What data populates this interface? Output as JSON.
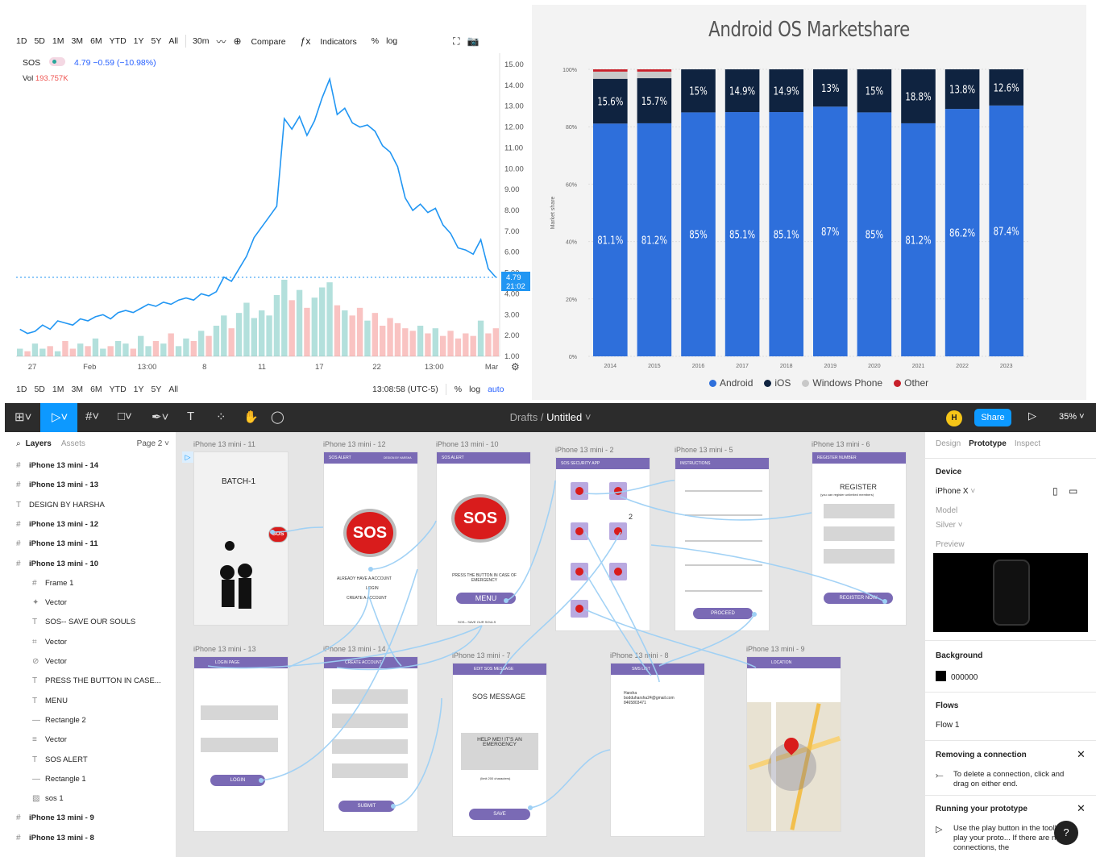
{
  "stock": {
    "timeframes": [
      "1D",
      "5D",
      "1M",
      "3M",
      "6M",
      "YTD",
      "1Y",
      "5Y",
      "All"
    ],
    "interval": "30m",
    "compare_label": "Compare",
    "indicators_label": "Indicators",
    "percent_label": "%",
    "log_label": "log",
    "symbol": "SOS",
    "change": "4.79 −0.59 (−10.98%)",
    "volume_label": "Vol",
    "volume_value": "193.757K",
    "price_tag": "4.79",
    "time_tag": "21:02",
    "clock": "13:08:58 (UTC-5)",
    "auto_label": "auto",
    "up_color": "#26a69a",
    "down_color": "#ef5350",
    "line_color": "#2196f3"
  },
  "android_chart": {
    "title": "Android OS Marketshare",
    "ylabel": "Market share",
    "legend": [
      "Android",
      "iOS",
      "Windows Phone",
      "Other"
    ]
  },
  "chart_data": [
    {
      "type": "line",
      "title": "",
      "xlabel": "",
      "ylabel": "",
      "x_ticks": [
        "27",
        "Feb",
        "13:00",
        "8",
        "11",
        "17",
        "22",
        "13:00",
        "Mar"
      ],
      "y_ticks": [
        "1.00",
        "2.00",
        "3.00",
        "4.00",
        "5.00",
        "6.00",
        "7.00",
        "8.00",
        "9.00",
        "10.00",
        "11.00",
        "12.00",
        "13.00",
        "14.00",
        "15.00"
      ],
      "ylim": [
        1,
        15
      ],
      "price": [
        2.3,
        2.1,
        2.2,
        2.5,
        2.3,
        2.7,
        2.6,
        2.5,
        2.8,
        2.7,
        2.9,
        3.0,
        2.8,
        3.1,
        3.2,
        3.1,
        3.3,
        3.5,
        3.4,
        3.6,
        3.5,
        3.7,
        3.8,
        3.7,
        4.0,
        3.9,
        4.1,
        4.8,
        4.6,
        5.2,
        5.8,
        6.7,
        7.2,
        7.7,
        8.2,
        12.4,
        11.9,
        12.5,
        11.6,
        12.3,
        13.4,
        14.3,
        12.6,
        12.9,
        12.2,
        12.0,
        12.1,
        11.8,
        11.1,
        10.8,
        10.1,
        8.6,
        8.0,
        8.3,
        7.9,
        8.1,
        7.3,
        6.9,
        6.2,
        6.1,
        5.9,
        6.6,
        5.2,
        4.79
      ],
      "volume": [
        0.3,
        0.2,
        0.5,
        0.3,
        0.4,
        0.2,
        0.6,
        0.3,
        0.5,
        0.4,
        0.7,
        0.3,
        0.4,
        0.6,
        0.5,
        0.3,
        0.8,
        0.4,
        0.6,
        0.5,
        0.9,
        0.4,
        0.7,
        0.6,
        1.0,
        0.8,
        1.2,
        1.6,
        1.1,
        1.7,
        2.1,
        1.5,
        1.8,
        1.6,
        2.4,
        3.0,
        2.2,
        2.6,
        1.9,
        2.3,
        2.7,
        2.9,
        2.0,
        1.8,
        1.6,
        1.9,
        1.4,
        1.7,
        1.2,
        1.5,
        1.3,
        1.1,
        1.0,
        1.2,
        0.9,
        1.1,
        0.8,
        1.0,
        0.7,
        0.9,
        0.8,
        1.4,
        0.9,
        1.1
      ],
      "last_price": 4.79
    },
    {
      "type": "bar",
      "title": "Android OS Marketshare",
      "ylabel": "Market share",
      "categories": [
        "2014",
        "2015",
        "2016",
        "2017",
        "2018",
        "2019",
        "2020",
        "2021",
        "2022",
        "2023"
      ],
      "y_ticks": [
        "0%",
        "20%",
        "40%",
        "60%",
        "80%",
        "100%"
      ],
      "ylim": [
        0,
        100
      ],
      "stacked": true,
      "series": [
        {
          "name": "Android",
          "color": "#2e6fdb",
          "values": [
            81.1,
            81.2,
            85,
            85.1,
            85.1,
            87,
            85,
            81.2,
            86.2,
            87.4
          ],
          "labels": [
            "81.1%",
            "81.2%",
            "85%",
            "85.1%",
            "85.1%",
            "87%",
            "85%",
            "81.2%",
            "86.2%",
            "87.4%"
          ]
        },
        {
          "name": "iOS",
          "color": "#0f2340",
          "values": [
            15.6,
            15.7,
            15,
            14.9,
            14.9,
            13,
            15,
            18.8,
            13.8,
            12.6
          ],
          "labels": [
            "15.6%",
            "15.7%",
            "15%",
            "14.9%",
            "14.9%",
            "13%",
            "15%",
            "18.8%",
            "13.8%",
            "12.6%"
          ]
        },
        {
          "name": "Windows Phone",
          "color": "#c8c8c8",
          "values": [
            2.5,
            2.3,
            0,
            0,
            0,
            0,
            0,
            0,
            0,
            0
          ]
        },
        {
          "name": "Other",
          "color": "#c8202a",
          "values": [
            0.8,
            0.8,
            0,
            0,
            0,
            0,
            0,
            0,
            0,
            0
          ]
        }
      ],
      "legend_position": "bottom"
    }
  ],
  "figma": {
    "breadcrumb_drafts": "Drafts",
    "separator": "/",
    "file_name": "Untitled",
    "avatar_letter": "H",
    "share_label": "Share",
    "zoom": "35%",
    "layers_tab": "Layers",
    "assets_tab": "Assets",
    "page": "Page 2",
    "layers": [
      {
        "icon": "#",
        "label": "iPhone 13 mini - 14",
        "bold": true,
        "indent": 0
      },
      {
        "icon": "#",
        "label": "iPhone 13 mini - 13",
        "bold": true,
        "indent": 0
      },
      {
        "icon": "T",
        "label": "DESIGN BY HARSHA",
        "bold": false,
        "indent": 0
      },
      {
        "icon": "#",
        "label": "iPhone 13 mini - 12",
        "bold": true,
        "indent": 0
      },
      {
        "icon": "#",
        "label": "iPhone 13 mini - 11",
        "bold": true,
        "indent": 0
      },
      {
        "icon": "#",
        "label": "iPhone 13 mini - 10",
        "bold": true,
        "indent": 0
      },
      {
        "icon": "#",
        "label": "Frame 1",
        "bold": false,
        "indent": 1
      },
      {
        "icon": "✦",
        "label": "Vector",
        "bold": false,
        "indent": 1
      },
      {
        "icon": "T",
        "label": "SOS-- SAVE OUR SOULS",
        "bold": false,
        "indent": 1
      },
      {
        "icon": "⌗",
        "label": "Vector",
        "bold": false,
        "indent": 1
      },
      {
        "icon": "⊘",
        "label": "Vector",
        "bold": false,
        "indent": 1
      },
      {
        "icon": "T",
        "label": "PRESS THE BUTTON IN CASE...",
        "bold": false,
        "indent": 1
      },
      {
        "icon": "T",
        "label": "MENU",
        "bold": false,
        "indent": 1
      },
      {
        "icon": "—",
        "label": "Rectangle 2",
        "bold": false,
        "indent": 1
      },
      {
        "icon": "≡",
        "label": "Vector",
        "bold": false,
        "indent": 1
      },
      {
        "icon": "T",
        "label": "SOS ALERT",
        "bold": false,
        "indent": 1
      },
      {
        "icon": "—",
        "label": "Rectangle 1",
        "bold": false,
        "indent": 1
      },
      {
        "icon": "▨",
        "label": "sos 1",
        "bold": false,
        "indent": 1
      },
      {
        "icon": "#",
        "label": "iPhone 13 mini - 9",
        "bold": true,
        "indent": 0
      },
      {
        "icon": "#",
        "label": "iPhone 13 mini - 8",
        "bold": true,
        "indent": 0
      }
    ],
    "frames_row1": [
      "iPhone 13 mini - 11",
      "iPhone 13 mini - 12",
      "iPhone 13 mini - 10",
      "iPhone 13 mini - 2",
      "iPhone 13 mini - 5",
      "iPhone 13 mini - 6"
    ],
    "frames_row2": [
      "iPhone 13 mini - 13",
      "iPhone 13 mini - 14",
      "iPhone 13 mini - 7",
      "iPhone 13 mini - 8",
      "iPhone 13 mini - 9"
    ],
    "screens": {
      "batch": "BATCH-1",
      "sos": "SOS",
      "sos_alert": "SOS ALERT",
      "design_by": "DESIGN BY HARSHA",
      "already": "ALREADY HAVE A ACCOUNT",
      "login": "LOGIN",
      "create": "CREATE A ACCOUNT",
      "press": "PRESS THE BUTTON IN CASE OF EMERGENCY",
      "menu": "MENU",
      "save_our": "SOS-- SAVE OUR SOULS",
      "security_app": "SOS SECURITY APP",
      "instructions": "INSTRUCTIONS",
      "proceed": "PROCEED",
      "register_number": "REGISTER NUMBER",
      "register": "REGISTER",
      "register_sub": "(you can register unlimited members)",
      "register_now": "REGISTER NOW",
      "login_page": "LOGIN PAGE",
      "create_account": "CREATE ACCOUNT",
      "submit": "SUBMIT",
      "edit_sos": "EDIT SOS MESSAGE",
      "sos_message": "SOS MESSAGE",
      "help_msg": "HELP ME!! IT'S AN EMERGENCY",
      "limit": "(limit 200 characters)",
      "save": "SAVE",
      "sms_list": "SMS LIST",
      "contact_name": "Harsha",
      "contact_email": "bodduharsha24@gmail.com",
      "contact_phone": "8465803471",
      "location": "LOCATION",
      "count_badge": "2"
    },
    "props": {
      "tabs": [
        "Design",
        "Prototype",
        "Inspect"
      ],
      "device_label": "Device",
      "device": "iPhone X",
      "model_label": "Model",
      "model": "Silver",
      "preview_label": "Preview",
      "background_label": "Background",
      "background": "000000",
      "flows_label": "Flows",
      "flow": "Flow 1",
      "removing_title": "Removing a connection",
      "removing_text": "To delete a connection, click and drag on either end.",
      "running_title": "Running your prototype",
      "running_text": "Use the play button in the toolbar to play your proto... If there are no connections, the",
      "help": "?"
    }
  }
}
